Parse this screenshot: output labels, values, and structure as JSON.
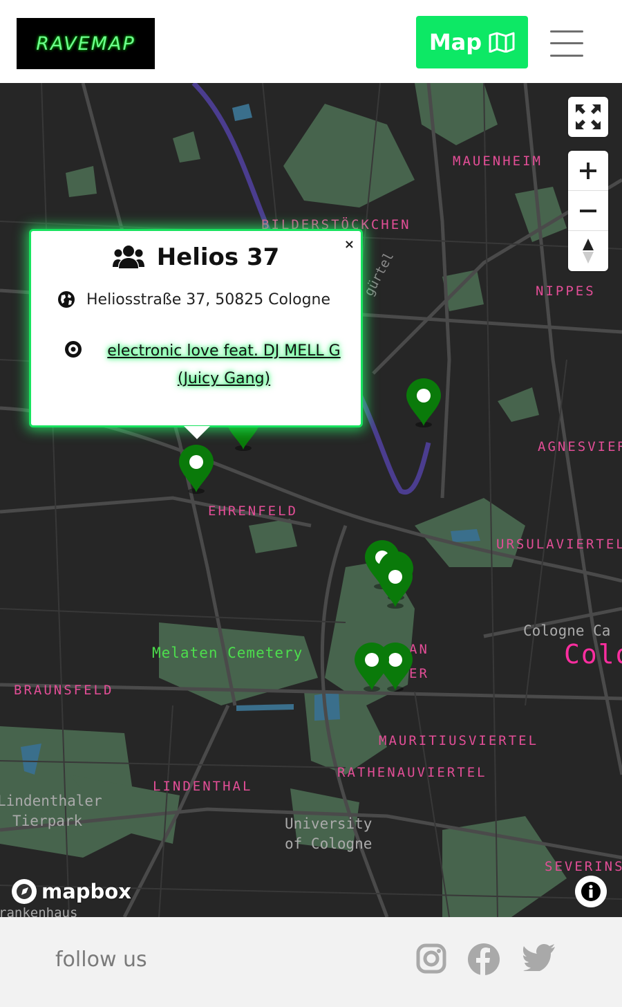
{
  "header": {
    "logo_text": "RAVEMAP",
    "map_button_label": "Map"
  },
  "map": {
    "places": [
      {
        "name": "MAUENHEIM"
      },
      {
        "name": "BILDERSTÖCKCHEN"
      },
      {
        "name": "NIPPES"
      },
      {
        "name": "AGNESVIER"
      },
      {
        "name": "URSULAVIERTEL"
      },
      {
        "name": "EHRENFELD"
      },
      {
        "name": "BRAUNSFELD"
      },
      {
        "name": "MAURITIUSVIERTEL"
      },
      {
        "name": "RATHENAUVIERTEL"
      },
      {
        "name": "LINDENTHAL"
      },
      {
        "name": "SEVERINS"
      },
      {
        "name": "AN"
      },
      {
        "name": "ER"
      }
    ],
    "cemetery_label": "Melaten Cemetery",
    "poi_cathedral": "Cologne Ca",
    "poi_university_1": "University",
    "poi_university_2": "of Cologne",
    "poi_tierpark_1": "Lindenthaler",
    "poi_tierpark_2": "Tierpark",
    "poi_krankenhaus": "rankenhaus",
    "city_label": "Colo",
    "ring_label": "gürtel",
    "attribution": "mapbox"
  },
  "popup": {
    "title": "Helios 37",
    "address": "Heliosstraße 37, 50825 Cologne",
    "event": "electronic love feat. DJ MELL G (Juicy Gang)",
    "close": "×"
  },
  "footer": {
    "follow_label": "follow us"
  },
  "colors": {
    "accent": "#0de865",
    "marker": "#0a7a0a",
    "district": "#e34e97"
  }
}
